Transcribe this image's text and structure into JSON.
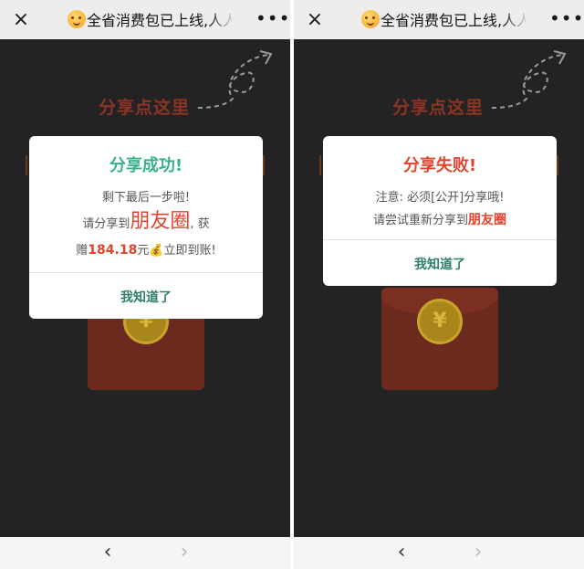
{
  "browser": {
    "close_icon": "×",
    "title": "全省消费包已上线,人人",
    "more_icon": "•••",
    "back_icon": "‹",
    "forward_icon": "›"
  },
  "background": {
    "share_hint": "分享点这里",
    "envelope_coin": "¥"
  },
  "success_dialog": {
    "title": "分享成功!",
    "line1": "剩下最后一步啦!",
    "line2_prefix": "请分享到",
    "line2_highlight": "朋友圈",
    "line2_suffix": ", 获",
    "line3_prefix": "赠",
    "line3_amount": "184.18",
    "line3_unit": "元",
    "line3_icon": "💰",
    "line3_suffix": "立即到账!",
    "ok_label": "我知道了",
    "title_color": "#3bb08f"
  },
  "fail_dialog": {
    "title": "分享失败!",
    "line1": "注意: 必须[公开]分享哦!",
    "line2_prefix": "请尝试重新分享到",
    "line2_highlight": "朋友圈",
    "ok_label": "我知道了",
    "title_color": "#e2452f"
  },
  "colors": {
    "accent_red": "#e2452f",
    "accent_green": "#3bb08f",
    "ok_text": "#2f7e6c",
    "dark_bg": "#232323"
  }
}
